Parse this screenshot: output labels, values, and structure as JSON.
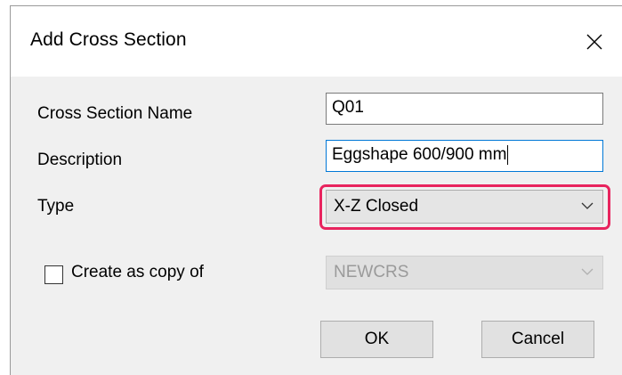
{
  "window": {
    "title": "Add Cross Section",
    "close_icon": "close-icon"
  },
  "form": {
    "name_label": "Cross Section Name",
    "name_value": "Q01",
    "description_label": "Description",
    "description_value": "Eggshape 600/900 mm",
    "type_label": "Type",
    "type_value": "X-Z Closed",
    "copy_label": "Create as copy of",
    "copy_checked": false,
    "copy_value": "NEWCRS"
  },
  "buttons": {
    "ok": "OK",
    "cancel": "Cancel"
  },
  "colors": {
    "highlight": "#e8245e",
    "dialog_bg": "#f0f0f0"
  }
}
